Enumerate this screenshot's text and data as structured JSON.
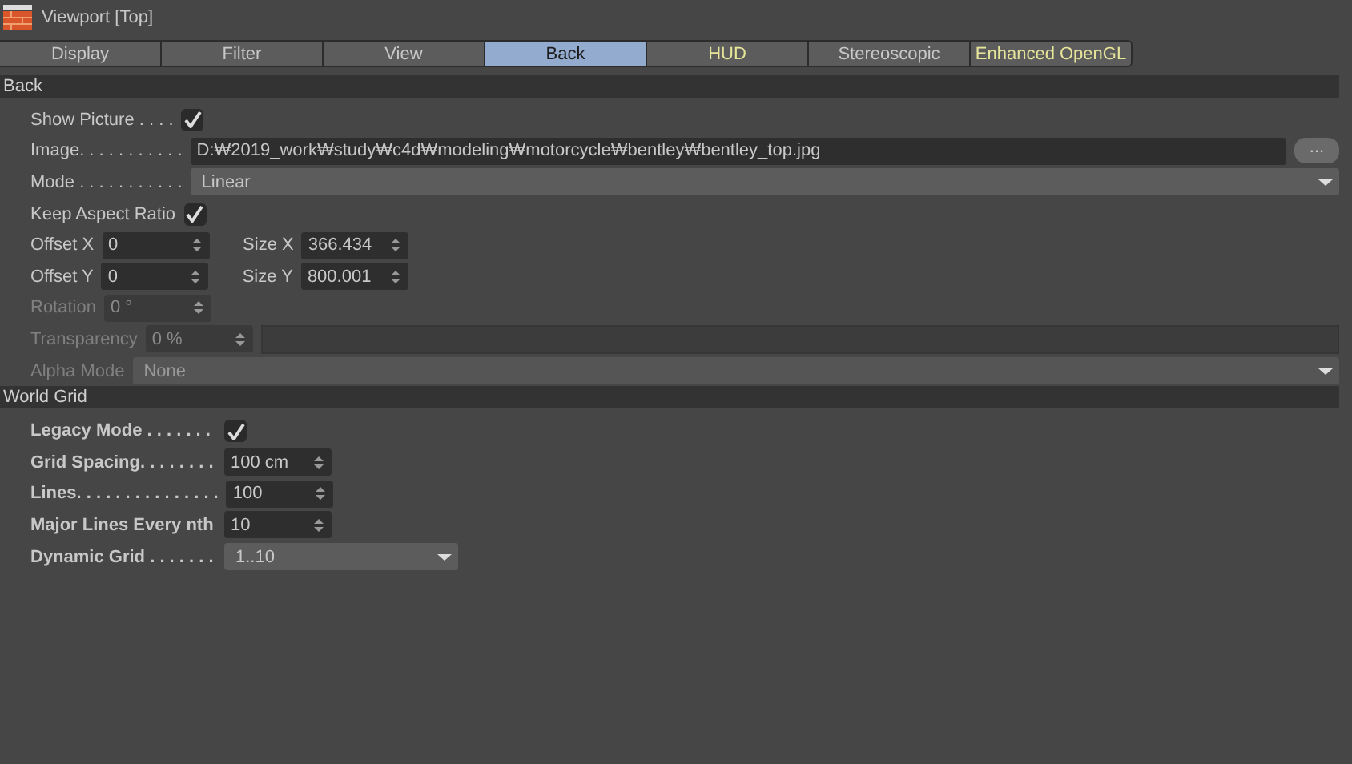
{
  "window": {
    "title": "Viewport [Top]"
  },
  "tabs": [
    {
      "label": "Display",
      "selected": false,
      "accent": false
    },
    {
      "label": "Filter",
      "selected": false,
      "accent": false
    },
    {
      "label": "View",
      "selected": false,
      "accent": false
    },
    {
      "label": "Back",
      "selected": true,
      "accent": false
    },
    {
      "label": "HUD",
      "selected": false,
      "accent": true
    },
    {
      "label": "Stereoscopic",
      "selected": false,
      "accent": false
    },
    {
      "label": "Enhanced OpenGL",
      "selected": false,
      "accent": true
    }
  ],
  "sections": [
    {
      "title": "Back",
      "bold_labels": false,
      "rows": [
        {
          "kind": "checkbox",
          "label": "Show Picture . . . .",
          "checked": true
        },
        {
          "kind": "path",
          "label": "Image. . . . . . . . . . .",
          "value": "D:₩2019_work₩study₩c4d₩modeling₩motorcycle₩bentley₩bentley_top.jpg",
          "button": "..."
        },
        {
          "kind": "dropdown",
          "label": "Mode . . . . . . . . . . .",
          "value": "Linear",
          "disabled": false
        },
        {
          "kind": "checkbox",
          "label": "Keep Aspect Ratio",
          "checked": true
        },
        {
          "kind": "pair",
          "fields": [
            {
              "label": "Offset X",
              "value": "0"
            },
            {
              "label": "Size X",
              "value": "366.434"
            }
          ]
        },
        {
          "kind": "pair",
          "fields": [
            {
              "label": "Offset Y",
              "value": "0"
            },
            {
              "label": "Size Y",
              "value": "800.001"
            }
          ]
        },
        {
          "kind": "number",
          "label": "Rotation",
          "value": "0 °",
          "disabled": true
        },
        {
          "kind": "slider",
          "label": "Transparency",
          "value": "0 %",
          "disabled": true,
          "level": 0
        },
        {
          "kind": "dropdown",
          "label": "Alpha Mode",
          "value": "None",
          "disabled": true
        }
      ]
    },
    {
      "title": "World Grid",
      "bold_labels": true,
      "rows": [
        {
          "kind": "checkbox",
          "label": "Legacy Mode . . . . . . .",
          "checked": true
        },
        {
          "kind": "number",
          "label": "Grid Spacing. . . . . . . .",
          "value": "100 cm",
          "disabled": false
        },
        {
          "kind": "number",
          "label": "Lines. . . . . . . . . . . . . . .",
          "value": "100",
          "disabled": false
        },
        {
          "kind": "number",
          "label": "Major Lines Every nth",
          "value": "10",
          "disabled": false
        },
        {
          "kind": "dropdown",
          "label": "Dynamic Grid . . . . . . .",
          "value": "1..10",
          "disabled": false
        }
      ]
    }
  ]
}
